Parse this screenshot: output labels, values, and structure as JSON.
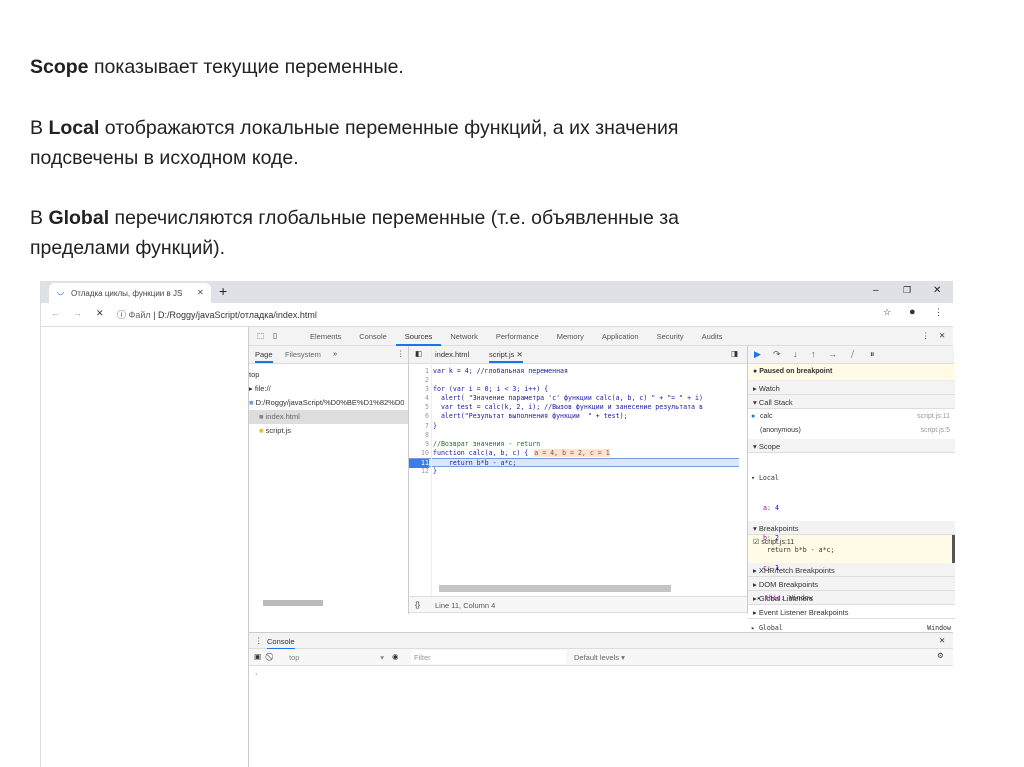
{
  "slide": {
    "p1_bold": "Scope",
    "p1_rest": " показывает текущие переменные.",
    "p2_pre": "В ",
    "p2_bold": "Local",
    "p2_rest": " отображаются локальные переменные функций, а их значения",
    "p2_line2": "подсвечены в исходном коде.",
    "p3_pre": "В ",
    "p3_bold": "Global",
    "p3_rest": " перечисляются глобальные переменные (т.е. объявленные за",
    "p3_line2": "пределами функций)."
  },
  "browser": {
    "tab_title": "Отладка циклы, функции в JS",
    "address_label": "Файл",
    "url": "D:/Roggy/javaScript/отладка/index.html"
  },
  "devtools": {
    "tabs": [
      "Elements",
      "Console",
      "Sources",
      "Network",
      "Performance",
      "Memory",
      "Application",
      "Security",
      "Audits"
    ],
    "active_tab": "Sources",
    "navigator": {
      "tabs": [
        "Page",
        "Filesystem"
      ],
      "tree": [
        "top",
        "file://",
        "D:/Roggy/javaScript/%D0%BE%D1%82%D0",
        "index.html",
        "script.js"
      ]
    },
    "editor": {
      "files": [
        "index.html",
        "script.js"
      ],
      "lines": [
        "var k = 4; //глобальная переменная",
        "",
        "for (var i = 0; i < 3; i++) {",
        "  alert( \"Значение параметра 'c' функции calc(a, b, c) \" + \"= \" + i)",
        "  var test = calc(k, 2, i); //Вызов функции и занесение результата в",
        "  alert(\"Результат выполнения функции  \" + test);",
        "}",
        "",
        "//Возврат значения - return",
        "function calc(a, b, c) {",
        "    return b*b - a*c;",
        "}"
      ],
      "inline_values": "a = 4, b = 2, c = 1",
      "current_line": 11,
      "status": "Line 11, Column 4"
    },
    "debugger": {
      "paused": "Paused on breakpoint",
      "watch": "Watch",
      "call_stack": "Call Stack",
      "frames": [
        {
          "name": "calc",
          "loc": "script.js:11"
        },
        {
          "name": "(anonymous)",
          "loc": "script.js:5"
        }
      ],
      "scope": "Scope",
      "local": "Local",
      "locals": [
        {
          "k": "a",
          "v": "4"
        },
        {
          "k": "b",
          "v": "2"
        },
        {
          "k": "c",
          "v": "1"
        },
        {
          "k": "this",
          "v": "Window"
        }
      ],
      "global": "Global",
      "global_value": "Window",
      "breakpoints": "Breakpoints",
      "bp_file": "script.js:11",
      "bp_code": "return b*b - a*c;",
      "other": [
        "XHR/fetch Breakpoints",
        "DOM Breakpoints",
        "Global Listeners",
        "Event Listener Breakpoints"
      ]
    },
    "console": {
      "tab": "Console",
      "context": "top",
      "filter_placeholder": "Filter",
      "levels": "Default levels ▾",
      "prompt": "›"
    }
  },
  "colors": {
    "accent": "#1a73e8",
    "paused_bg": "#fffbe6",
    "highlight_line": "#dbe6fb",
    "inline_bg": "#fde3d0"
  }
}
